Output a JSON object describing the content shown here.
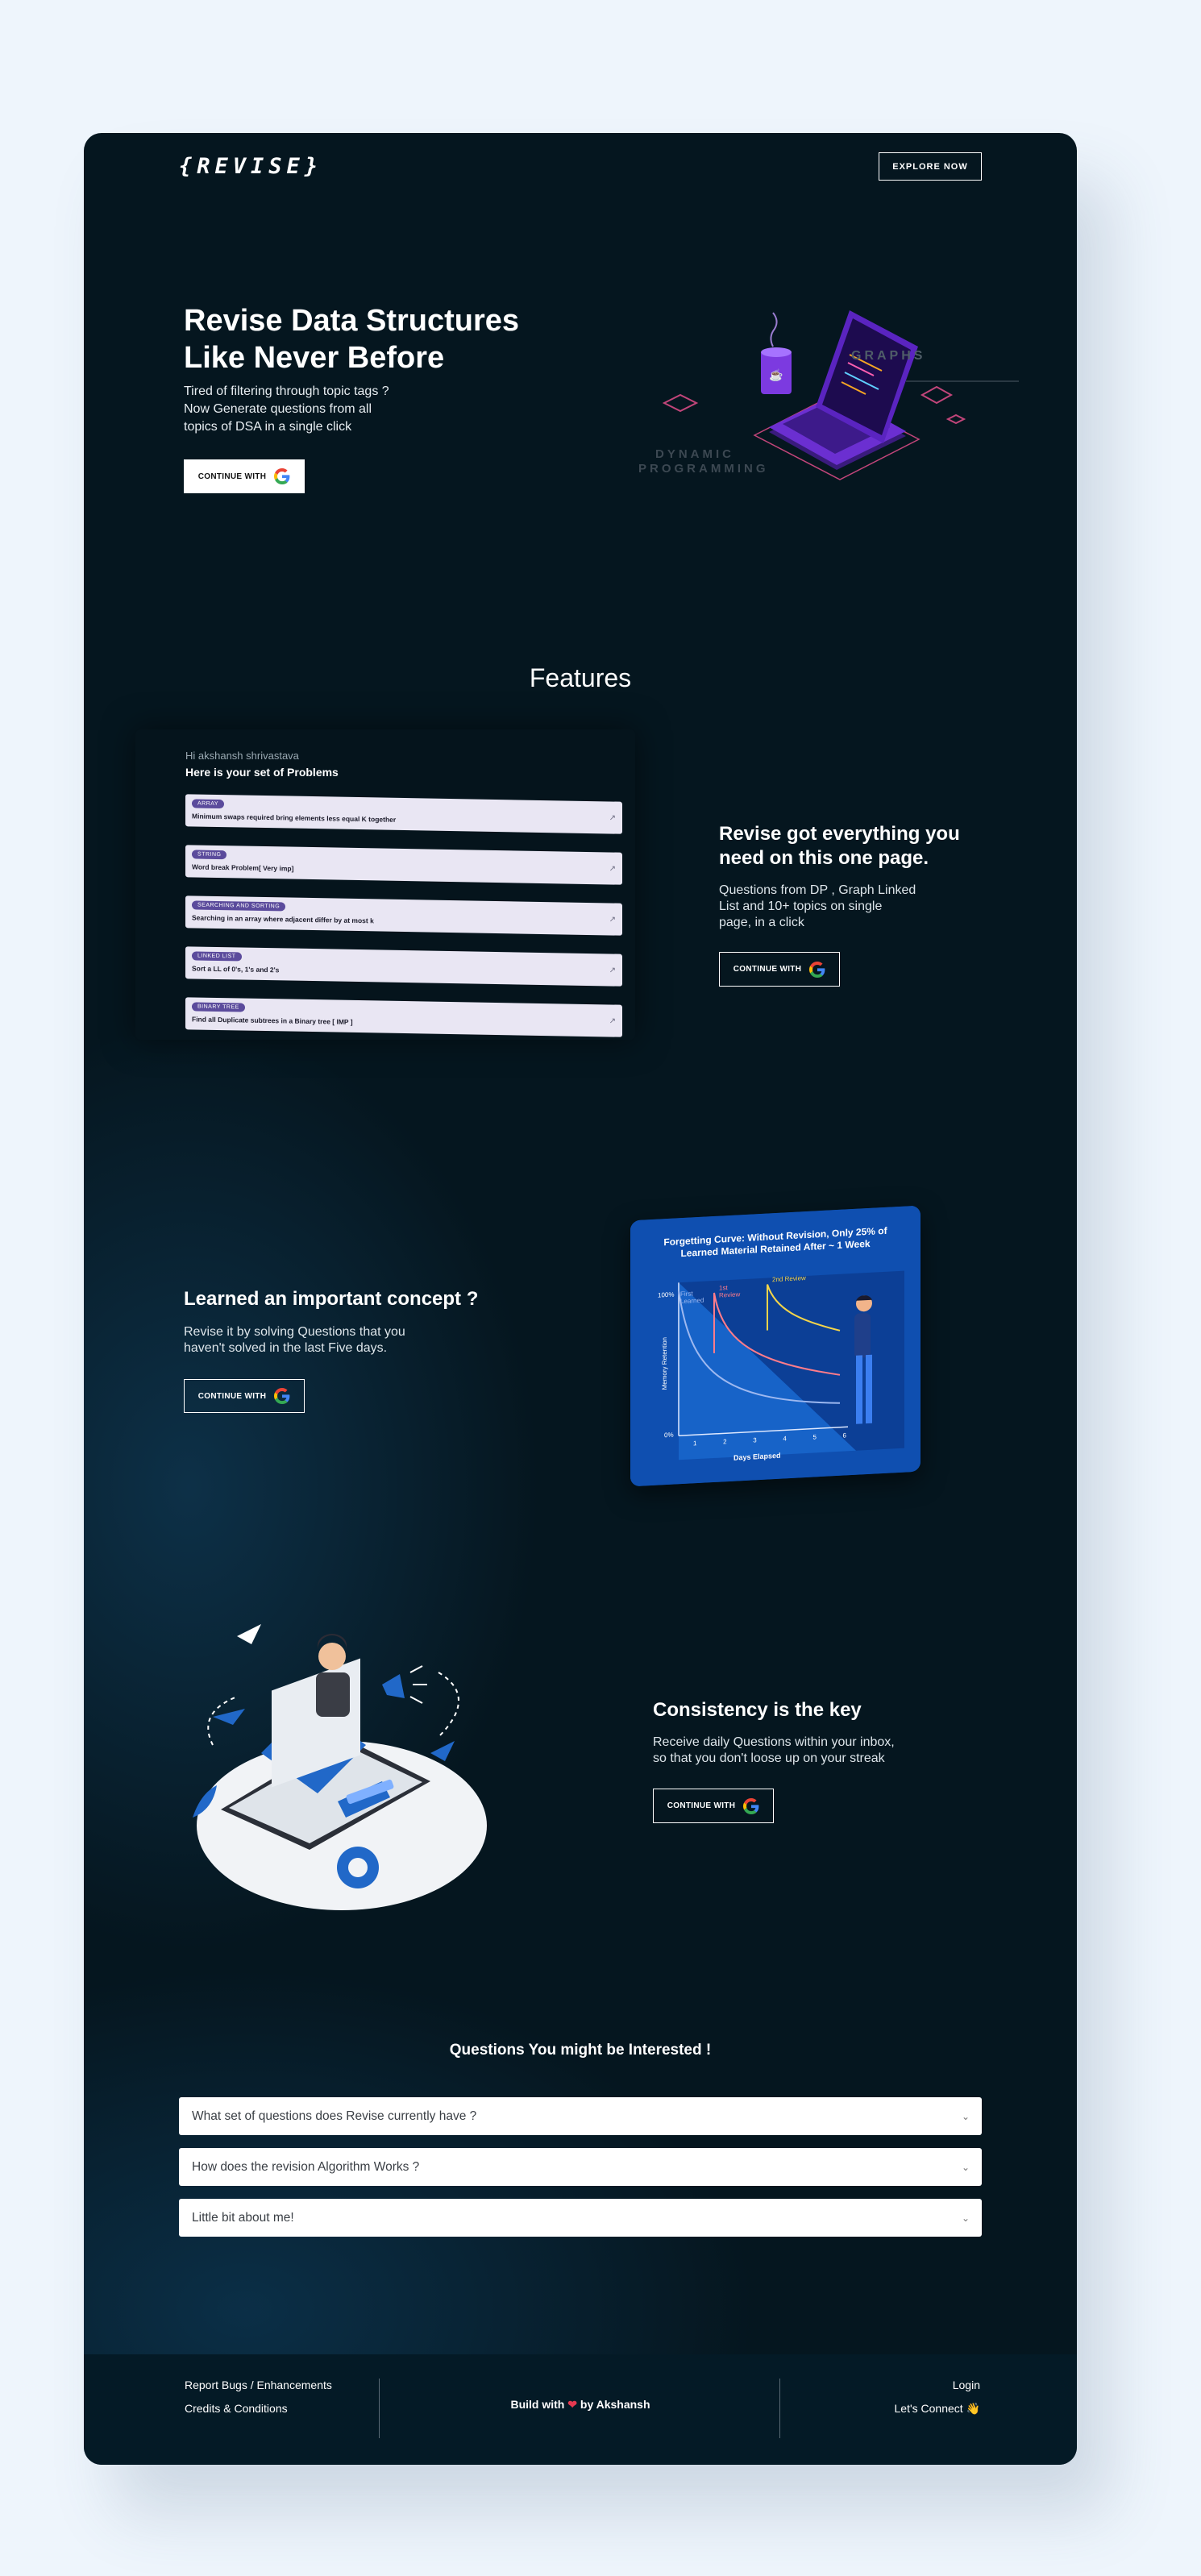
{
  "header": {
    "logo": "{REVISE}",
    "explore_label": "EXPLORE NOW"
  },
  "hero": {
    "title_line1": "Revise Data Structures",
    "title_line2": "Like Never Before",
    "sub_line1": "Tired of filtering through topic tags ?",
    "sub_line2": "Now Generate questions from all",
    "sub_line3": "topics of DSA in a single click",
    "cta": "CONTINUE WITH",
    "illus_label1": "GRAPHS",
    "illus_label2": "DYNAMIC",
    "illus_label3": "PROGRAMMING"
  },
  "features": {
    "title": "Features",
    "panel": {
      "greeting": "Hi akshansh shrivastava",
      "heading": "Here is your set of Problems",
      "problems": [
        {
          "tag": "ARRAY",
          "text": "Minimum swaps required bring elements less equal K together"
        },
        {
          "tag": "STRING",
          "text": "Word break Problem[ Very imp]"
        },
        {
          "tag": "SEARCHING AND SORTING",
          "text": "Searching in an array where adjacent differ by at most k"
        },
        {
          "tag": "LINKED LIST",
          "text": "Sort a LL of 0's, 1's and 2's"
        },
        {
          "tag": "BINARY TREE",
          "text": "Find all Duplicate subtrees in a Binary tree [ IMP ]"
        }
      ]
    },
    "f1": {
      "title_line1": "Revise got everything you",
      "title_line2": "need on this one page.",
      "sub_line1": "Questions from DP , Graph Linked",
      "sub_line2": "List and 10+ topics on single",
      "sub_line3": "page, in a click",
      "cta": "CONTINUE WITH"
    },
    "f2": {
      "title": "Learned an important concept ?",
      "sub_line1": "Revise it by solving Questions that you",
      "sub_line2": "haven't solved in the last Five days.",
      "cta": "CONTINUE WITH",
      "curve": {
        "title_line1": "Forgetting Curve: Without Revision, Only 25% of",
        "title_line2": "Learned Material Retained After ~ 1 Week",
        "y_top": "100%",
        "y_bottom": "0%",
        "ylabel": "Memory Retention",
        "xlabel": "Days Elapsed",
        "x_ticks": [
          "1",
          "2",
          "3",
          "4",
          "5",
          "6"
        ],
        "first_learned": "First Learned",
        "review1": "1st Review",
        "review2": "2nd Review"
      }
    },
    "f3": {
      "title": "Consistency is the key",
      "sub_line1": "Receive daily Questions within your inbox,",
      "sub_line2": "so that you don't loose up on your streak",
      "cta": "CONTINUE WITH"
    }
  },
  "faq": {
    "title": "Questions You might be Interested !",
    "items": [
      "What set of questions does Revise currently have ?",
      "How does the revision Algorithm Works ?",
      "Little bit about me!"
    ]
  },
  "footer": {
    "report": "Report Bugs / Enhancements",
    "credits": "Credits & Conditions",
    "build_prefix": "Build with",
    "build_suffix": "by Akshansh",
    "login": "Login",
    "connect": "Let's Connect"
  },
  "colors": {
    "page_bg": "#eef5fc",
    "card_bg": "#05161f",
    "accent_blue": "#1f6fd6",
    "tag_purple": "#5b4b9c"
  },
  "icons": [
    "google-icon",
    "chevron-down-icon",
    "external-link-icon",
    "heart-icon",
    "wave-hand-icon"
  ]
}
